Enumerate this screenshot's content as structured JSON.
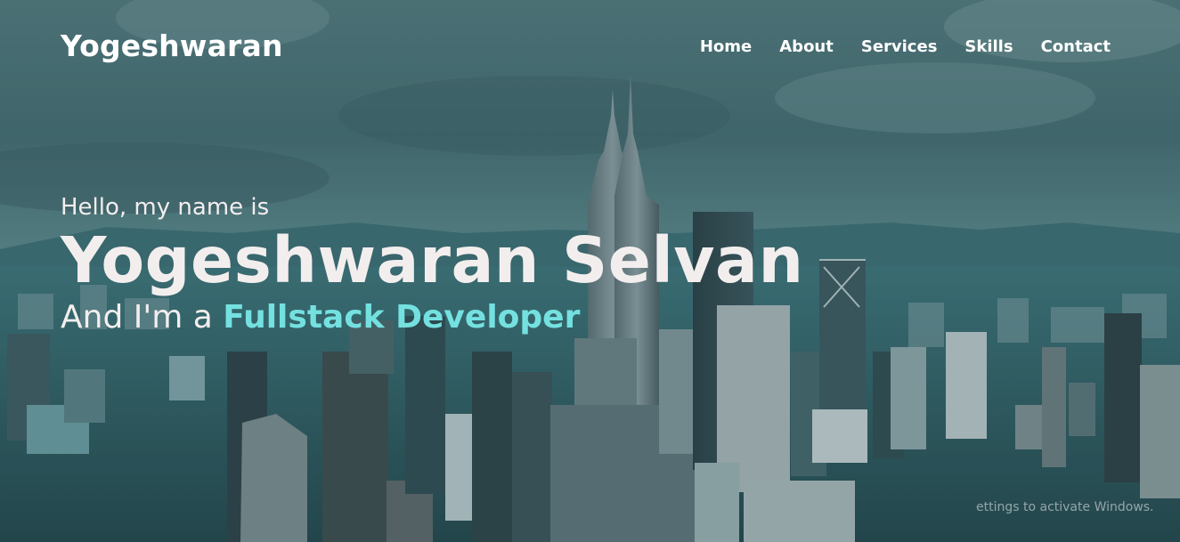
{
  "navbar": {
    "logo": "Yogeshwaran",
    "menu": [
      {
        "label": "Home"
      },
      {
        "label": "About"
      },
      {
        "label": "Services"
      },
      {
        "label": "Skills"
      },
      {
        "label": "Contact"
      }
    ]
  },
  "home": {
    "greeting": "Hello, my name is",
    "name": "Yogeshwaran Selvan",
    "role_prefix": "And I'm a ",
    "role": "Fullstack Developer"
  },
  "os_watermark": "ettings to activate Windows.",
  "colors": {
    "accent": "#74e1e0",
    "text": "#f3eeee"
  },
  "background": "city-skyline-photo"
}
